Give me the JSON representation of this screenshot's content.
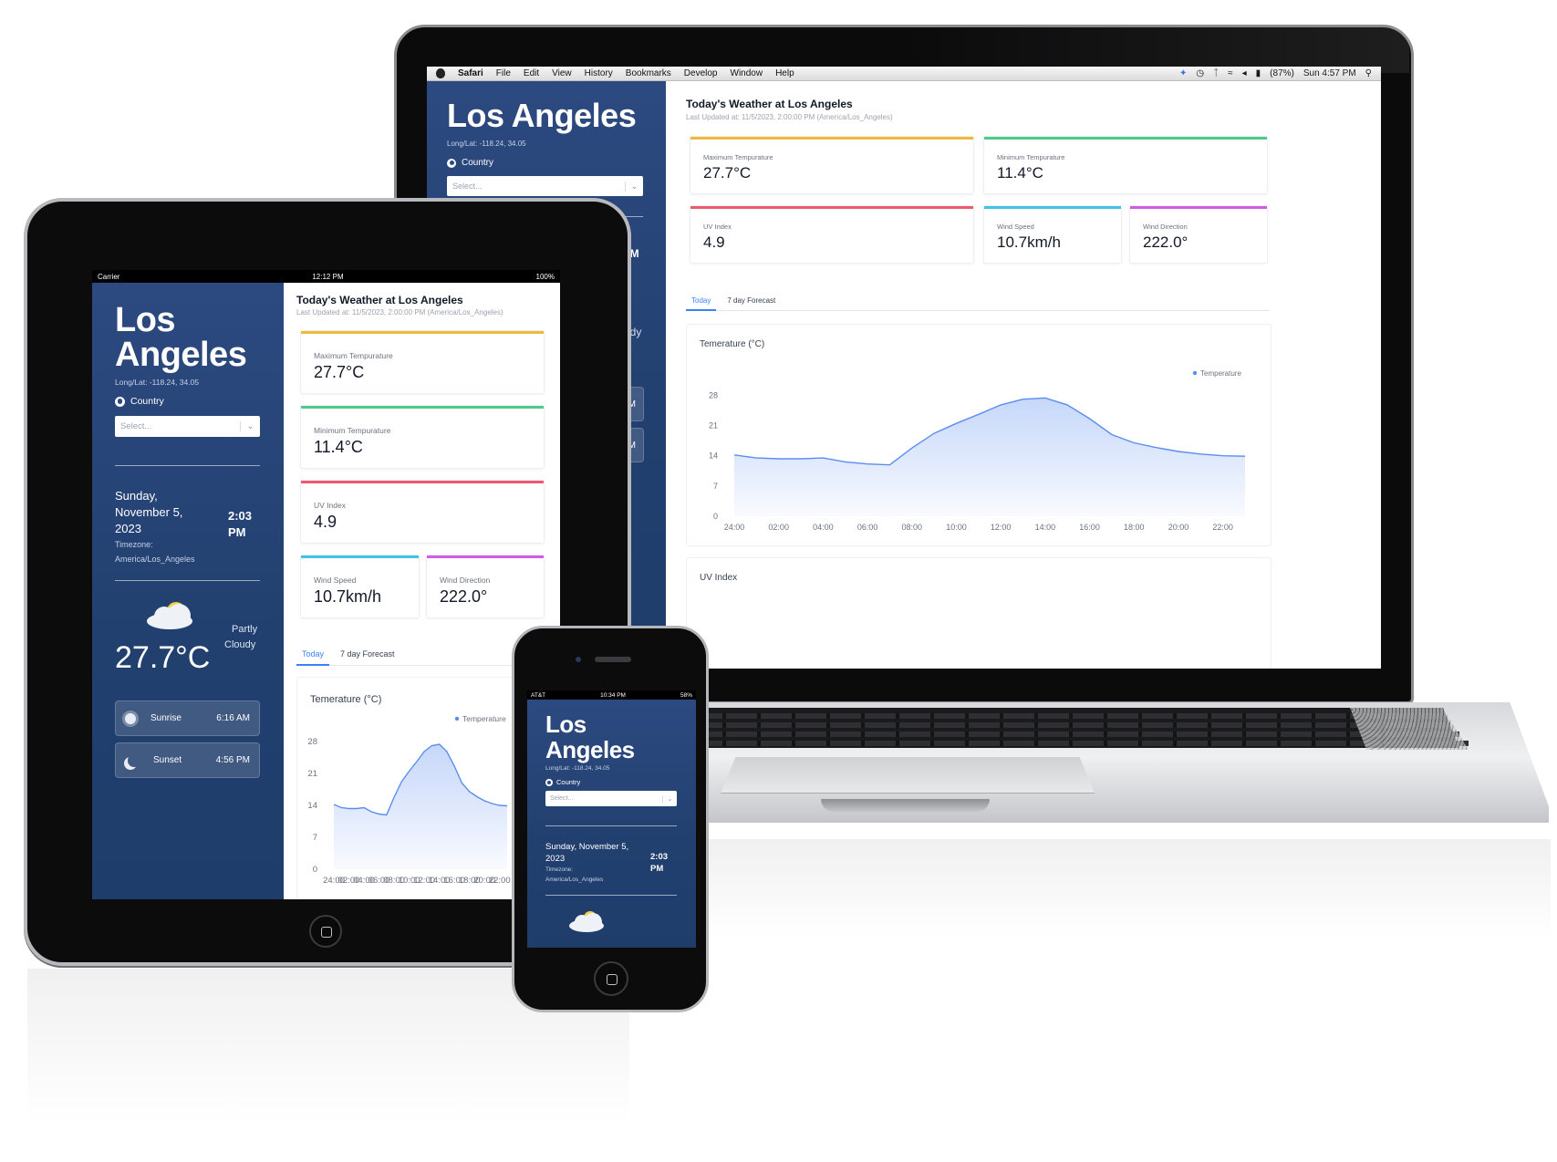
{
  "laptop": {
    "menubar": {
      "app": "Safari",
      "items": [
        "File",
        "Edit",
        "View",
        "History",
        "Bookmarks",
        "Develop",
        "Window",
        "Help"
      ],
      "battery": "(87%)",
      "clock": "Sun 4:57 PM"
    }
  },
  "tablet_status": {
    "carrier": "Carrier",
    "time": "12:12 PM",
    "battery": "100%"
  },
  "phone_status": {
    "carrier": "AT&T",
    "time": "10:34 PM",
    "battery": "58%"
  },
  "sidebar": {
    "city": "Los Angeles",
    "city_line1": "Los",
    "city_line2": "Angeles",
    "coords": "Long/Lat: -118.24, 34.05",
    "country_label": "Country",
    "select_placeholder": "Select...",
    "date": "Sunday, November 5, 2023",
    "date_line1": "Sunday,",
    "date_line2": "November 5,",
    "date_line3": "2023",
    "phone_date_line1": "Sunday, November 5,",
    "phone_date_line2": "2023",
    "time": "2:03 PM",
    "time_line1": "2:03",
    "time_line2": "PM",
    "timezone_label": "Timezone:",
    "timezone": "America/Los_Angeles",
    "condition_line1": "Partly",
    "condition_line2": "Cloudy",
    "temperature": "27.7°C",
    "sunrise_label": "Sunrise",
    "sunrise_time": "6:16 AM",
    "sunset_label": "Sunset",
    "sunset_time": "4:56 PM",
    "laptop_peek": {
      "time": "03 PM",
      "cond": "Cloudy",
      "sunrise": "16 AM",
      "sunset": "56 PM"
    }
  },
  "main": {
    "title": "Today's Weather at Los Angeles",
    "updated": "Last Updated at: 11/5/2023, 2:00:00 PM (America/Los_Angeles)",
    "cards": {
      "max_label": "Maximum Tempurature",
      "max_value": "27.7°C",
      "max_color": "#f0b93a",
      "min_label": "Minimum Tempurature",
      "min_value": "11.4°C",
      "min_color": "#4fc98a",
      "uv_label": "UV Index",
      "uv_value": "4.9",
      "uv_color": "#ef5a70",
      "wind_label": "Wind Speed",
      "wind_value": "10.7km/h",
      "wind_color": "#3fc4e8",
      "dir_label": "Wind Direction",
      "dir_value": "222.0°",
      "dir_color": "#d15be8"
    },
    "tabs": [
      "Today",
      "7 day Forecast"
    ],
    "uv_chart_title": "UV Index"
  },
  "chart_data": {
    "type": "area",
    "title": "Temerature (°C)",
    "series": [
      {
        "name": "Temperature",
        "x": [
          "24:00",
          "01:00",
          "02:00",
          "03:00",
          "04:00",
          "05:00",
          "06:00",
          "07:00",
          "08:00",
          "09:00",
          "10:00",
          "11:00",
          "12:00",
          "13:00",
          "14:00",
          "15:00",
          "16:00",
          "17:00",
          "18:00",
          "19:00",
          "20:00",
          "21:00",
          "22:00",
          "23:00"
        ],
        "values": [
          14.2,
          13.5,
          13.3,
          13.3,
          13.5,
          12.6,
          12.1,
          11.9,
          15.8,
          19.2,
          21.5,
          23.6,
          25.8,
          27.1,
          27.4,
          25.8,
          22.6,
          18.9,
          17.0,
          15.9,
          15.0,
          14.4,
          14.0,
          13.9
        ]
      }
    ],
    "xticks": [
      "24:00",
      "02:00",
      "04:00",
      "06:00",
      "08:00",
      "10:00",
      "12:00",
      "14:00",
      "16:00",
      "18:00",
      "20:00",
      "22:00"
    ],
    "yticks": [
      0,
      7,
      14,
      21,
      28
    ],
    "ylim": [
      0,
      30
    ],
    "legend": "top-right",
    "color": "#5b8def"
  }
}
